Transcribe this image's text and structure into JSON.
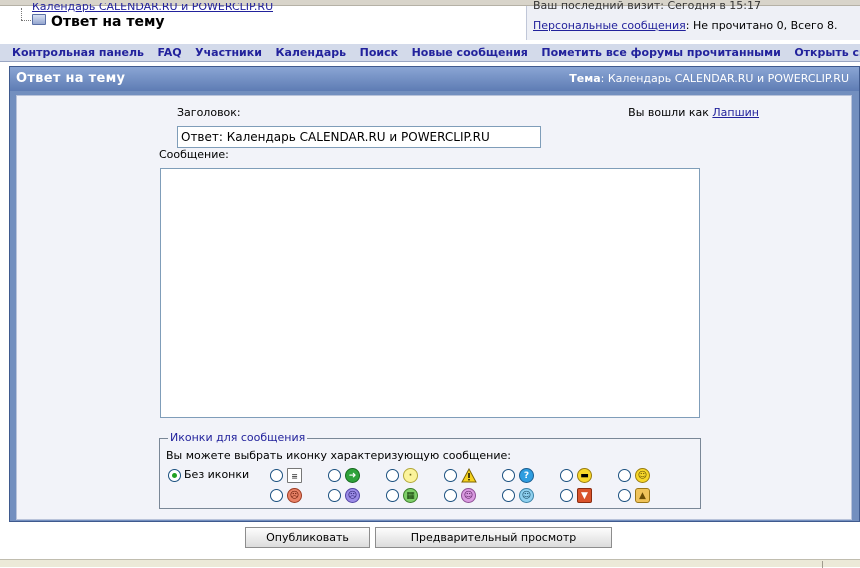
{
  "breadcrumb": {
    "parent": "Календарь CALENDAR.RU и POWERCLIP.RU",
    "current": "Ответ на тему"
  },
  "info": {
    "top_text": "Ваш последний визит: Сегодня в 15:17",
    "pm_link": "Персональные сообщения",
    "pm_status": ": Не прочитано 0, Всего 8."
  },
  "nav": {
    "items": [
      "Контрольная панель",
      "FAQ",
      "Участники",
      "Календарь",
      "Поиск",
      "Новые сообщения",
      "Пометить все форумы прочитанными",
      "Открыть список друзей"
    ]
  },
  "panel": {
    "title": "Ответ на тему",
    "topic_label": "Тема",
    "topic_value": ": Календарь CALENDAR.RU и POWERCLIP.RU"
  },
  "form": {
    "subject_label": "Заголовок:",
    "subject_value": "Ответ: Календарь CALENDAR.RU и POWERCLIP.RU",
    "logged_in_prefix": "Вы вошли как ",
    "username": "Лапшин",
    "message_label": "Сообщение:",
    "message_value": ""
  },
  "icons": {
    "legend": "Иконки для сообщения",
    "description": "Вы можете выбрать иконку характеризующую сообщение:",
    "no_icon_label": "Без иконки",
    "selected": "none",
    "row1": [
      "doc-icon",
      "arrow-icon",
      "lightbulb-icon",
      "warning-icon",
      "question-icon",
      "cool-icon",
      "smile-icon"
    ],
    "row2": [
      "angry-icon",
      "sad-icon",
      "grin-icon",
      "pink-smile-icon",
      "blue-smile-icon",
      "thumbs-down-icon",
      "thumbs-up-icon"
    ]
  },
  "buttons": {
    "publish": "Опубликовать",
    "preview": "Предварительный просмотр"
  }
}
